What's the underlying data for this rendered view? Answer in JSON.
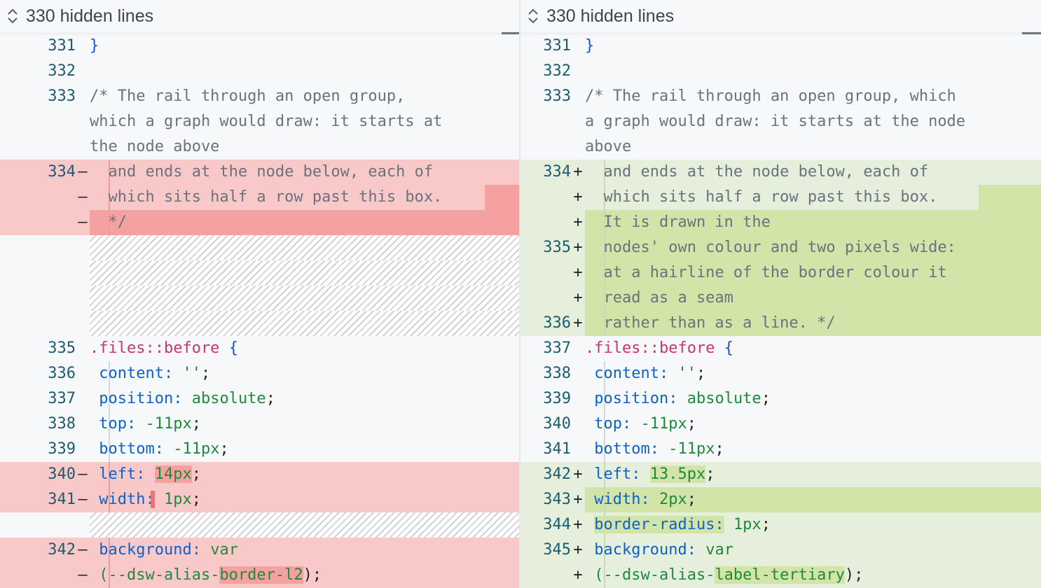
{
  "left": {
    "hidden_lines_label": "330 hidden lines",
    "rows": [
      {
        "type": "ctx",
        "num": "331",
        "mark": "",
        "segs": [
          {
            "t": "}",
            "c": "brace"
          }
        ]
      },
      {
        "type": "ctx",
        "num": "332",
        "mark": "",
        "segs": []
      },
      {
        "type": "ctx",
        "num": "333",
        "mark": "",
        "segs": [
          {
            "t": "/* The rail through an open group,",
            "c": "com"
          }
        ]
      },
      {
        "type": "ctx",
        "num": "",
        "mark": "",
        "segs": [
          {
            "t": "which a graph would draw: it starts at",
            "c": "com"
          }
        ]
      },
      {
        "type": "ctx",
        "num": "",
        "mark": "",
        "segs": [
          {
            "t": "the node above",
            "c": "com"
          }
        ]
      },
      {
        "type": "del",
        "num": "334",
        "mark": "—",
        "rail": true,
        "segs": [
          {
            "t": "  and ends at the node below, each of",
            "c": "com"
          }
        ]
      },
      {
        "type": "del",
        "num": "",
        "mark": "—",
        "rail": true,
        "segs": [
          {
            "t": "  which sits half a row past this box.",
            "c": "com"
          }
        ]
      },
      {
        "type": "del",
        "num": "",
        "mark": "—",
        "rail": true,
        "segs": [
          {
            "t": "  */",
            "c": "com"
          }
        ]
      },
      {
        "type": "hatch"
      },
      {
        "type": "hatch"
      },
      {
        "type": "hatch"
      },
      {
        "type": "hatch"
      },
      {
        "type": "ctx",
        "num": "335",
        "mark": "",
        "segs": [
          {
            "t": ".files::before",
            "c": "sel"
          },
          {
            "t": " ",
            "c": "pun"
          },
          {
            "t": "{",
            "c": "brace"
          }
        ]
      },
      {
        "type": "ctx",
        "num": "336",
        "mark": "",
        "rail": true,
        "segs": [
          {
            "t": " ",
            "c": "pun"
          },
          {
            "t": "content:",
            "c": "prop"
          },
          {
            "t": " ",
            "c": "pun"
          },
          {
            "t": "''",
            "c": "str"
          },
          {
            "t": ";",
            "c": "pun"
          }
        ]
      },
      {
        "type": "ctx",
        "num": "337",
        "mark": "",
        "rail": true,
        "segs": [
          {
            "t": " ",
            "c": "pun"
          },
          {
            "t": "position:",
            "c": "prop"
          },
          {
            "t": " absolute",
            "c": "val"
          },
          {
            "t": ";",
            "c": "pun"
          }
        ]
      },
      {
        "type": "ctx",
        "num": "338",
        "mark": "",
        "rail": true,
        "segs": [
          {
            "t": " ",
            "c": "pun"
          },
          {
            "t": "top:",
            "c": "prop"
          },
          {
            "t": " -11px",
            "c": "num"
          },
          {
            "t": ";",
            "c": "pun"
          }
        ]
      },
      {
        "type": "ctx",
        "num": "339",
        "mark": "",
        "rail": true,
        "segs": [
          {
            "t": " ",
            "c": "pun"
          },
          {
            "t": "bottom:",
            "c": "prop"
          },
          {
            "t": " -11px",
            "c": "num"
          },
          {
            "t": ";",
            "c": "pun"
          }
        ]
      },
      {
        "type": "del",
        "num": "340",
        "mark": "—",
        "rail": true,
        "segs": [
          {
            "t": " ",
            "c": "pun"
          },
          {
            "t": "left:",
            "c": "prop"
          },
          {
            "t": " ",
            "c": "pun"
          },
          {
            "t": "14px",
            "c": "num",
            "hl": true
          },
          {
            "t": ";",
            "c": "pun"
          }
        ]
      },
      {
        "type": "del",
        "num": "341",
        "mark": "—",
        "rail": true,
        "segs": [
          {
            "t": " ",
            "c": "pun"
          },
          {
            "t": "width:",
            "c": "prop"
          },
          {
            "t": " ",
            "c": "pun",
            "hlbar": true
          },
          {
            "t": "1px",
            "c": "num"
          },
          {
            "t": ";",
            "c": "pun"
          }
        ]
      },
      {
        "type": "hatch"
      },
      {
        "type": "del",
        "num": "342",
        "mark": "—",
        "rail": true,
        "segs": [
          {
            "t": " ",
            "c": "pun"
          },
          {
            "t": "background:",
            "c": "prop"
          },
          {
            "t": " var",
            "c": "val"
          }
        ]
      },
      {
        "type": "del",
        "num": "",
        "mark": "—",
        "rail": true,
        "segs": [
          {
            "t": " ",
            "c": "pun"
          },
          {
            "t": "(--dsw-alias-",
            "c": "val"
          },
          {
            "t": "border-l2",
            "c": "val",
            "hl": true
          },
          {
            "t": ");",
            "c": "pun"
          }
        ]
      }
    ]
  },
  "right": {
    "hidden_lines_label": "330 hidden lines",
    "rows": [
      {
        "type": "ctx",
        "num": "331",
        "mark": "",
        "segs": [
          {
            "t": "}",
            "c": "brace"
          }
        ]
      },
      {
        "type": "ctx",
        "num": "332",
        "mark": "",
        "segs": []
      },
      {
        "type": "ctx",
        "num": "333",
        "mark": "",
        "segs": [
          {
            "t": "/* The rail through an open group, which",
            "c": "com"
          }
        ]
      },
      {
        "type": "ctx",
        "num": "",
        "mark": "",
        "segs": [
          {
            "t": "a graph would draw: it starts at the node",
            "c": "com"
          }
        ]
      },
      {
        "type": "ctx",
        "num": "",
        "mark": "",
        "segs": [
          {
            "t": "above",
            "c": "com"
          }
        ]
      },
      {
        "type": "add",
        "num": "334",
        "mark": "+",
        "rail": true,
        "segs": [
          {
            "t": "  and ends at the node below, each of",
            "c": "com"
          }
        ]
      },
      {
        "type": "add",
        "num": "",
        "mark": "+",
        "rail": true,
        "segs": [
          {
            "t": "  which sits half a row past this box.",
            "c": "com"
          }
        ]
      },
      {
        "type": "add",
        "num": "",
        "mark": "+",
        "rail": true,
        "full": true,
        "segs": [
          {
            "t": "  It is drawn in the",
            "c": "com"
          }
        ]
      },
      {
        "type": "add",
        "num": "335",
        "mark": "+",
        "rail": true,
        "full": true,
        "segs": [
          {
            "t": "  nodes' own colour and two pixels wide:",
            "c": "com"
          }
        ]
      },
      {
        "type": "add",
        "num": "",
        "mark": "+",
        "rail": true,
        "full": true,
        "segs": [
          {
            "t": "  at a hairline of the border colour it",
            "c": "com"
          }
        ]
      },
      {
        "type": "add",
        "num": "",
        "mark": "+",
        "rail": true,
        "full": true,
        "segs": [
          {
            "t": "  read as a seam",
            "c": "com"
          }
        ]
      },
      {
        "type": "add",
        "num": "336",
        "mark": "+",
        "rail": true,
        "full": true,
        "segs": [
          {
            "t": "  rather than as a line. */",
            "c": "com"
          }
        ]
      },
      {
        "type": "ctx",
        "num": "337",
        "mark": "",
        "segs": [
          {
            "t": ".files::before",
            "c": "sel"
          },
          {
            "t": " ",
            "c": "pun"
          },
          {
            "t": "{",
            "c": "brace"
          }
        ]
      },
      {
        "type": "ctx",
        "num": "338",
        "mark": "",
        "rail": true,
        "segs": [
          {
            "t": " ",
            "c": "pun"
          },
          {
            "t": "content:",
            "c": "prop"
          },
          {
            "t": " ",
            "c": "pun"
          },
          {
            "t": "''",
            "c": "str"
          },
          {
            "t": ";",
            "c": "pun"
          }
        ]
      },
      {
        "type": "ctx",
        "num": "339",
        "mark": "",
        "rail": true,
        "segs": [
          {
            "t": " ",
            "c": "pun"
          },
          {
            "t": "position:",
            "c": "prop"
          },
          {
            "t": " absolute",
            "c": "val"
          },
          {
            "t": ";",
            "c": "pun"
          }
        ]
      },
      {
        "type": "ctx",
        "num": "340",
        "mark": "",
        "rail": true,
        "segs": [
          {
            "t": " ",
            "c": "pun"
          },
          {
            "t": "top:",
            "c": "prop"
          },
          {
            "t": " -11px",
            "c": "num"
          },
          {
            "t": ";",
            "c": "pun"
          }
        ]
      },
      {
        "type": "ctx",
        "num": "341",
        "mark": "",
        "rail": true,
        "segs": [
          {
            "t": " ",
            "c": "pun"
          },
          {
            "t": "bottom:",
            "c": "prop"
          },
          {
            "t": " -11px",
            "c": "num"
          },
          {
            "t": ";",
            "c": "pun"
          }
        ]
      },
      {
        "type": "add",
        "num": "342",
        "mark": "+",
        "rail": true,
        "segs": [
          {
            "t": " ",
            "c": "pun"
          },
          {
            "t": "left:",
            "c": "prop"
          },
          {
            "t": " ",
            "c": "pun"
          },
          {
            "t": "13.5px",
            "c": "num",
            "hl": true
          },
          {
            "t": ";",
            "c": "pun"
          }
        ]
      },
      {
        "type": "add",
        "num": "343",
        "mark": "+",
        "rail": true,
        "full": true,
        "segs": [
          {
            "t": " ",
            "c": "pun"
          },
          {
            "t": "width:",
            "c": "prop"
          },
          {
            "t": " ",
            "c": "pun"
          },
          {
            "t": "2px",
            "c": "num"
          },
          {
            "t": ";",
            "c": "pun"
          }
        ]
      },
      {
        "type": "add",
        "num": "344",
        "mark": "+",
        "rail": true,
        "segs": [
          {
            "t": " ",
            "c": "pun"
          },
          {
            "t": "border-radius:",
            "c": "prop",
            "hl": true
          },
          {
            "t": " ",
            "c": "pun"
          },
          {
            "t": "1px",
            "c": "num"
          },
          {
            "t": ";",
            "c": "pun"
          }
        ]
      },
      {
        "type": "add",
        "num": "345",
        "mark": "+",
        "rail": true,
        "segs": [
          {
            "t": " ",
            "c": "pun"
          },
          {
            "t": "background:",
            "c": "prop"
          },
          {
            "t": " var",
            "c": "val"
          }
        ]
      },
      {
        "type": "add",
        "num": "",
        "mark": "+",
        "rail": true,
        "segs": [
          {
            "t": " ",
            "c": "pun"
          },
          {
            "t": "(--dsw-alias-",
            "c": "val"
          },
          {
            "t": "label-tertiary",
            "c": "val",
            "hl": true
          },
          {
            "t": ");",
            "c": "pun"
          }
        ]
      }
    ]
  },
  "icons": {
    "expand": "chevron-up-down-icon"
  }
}
